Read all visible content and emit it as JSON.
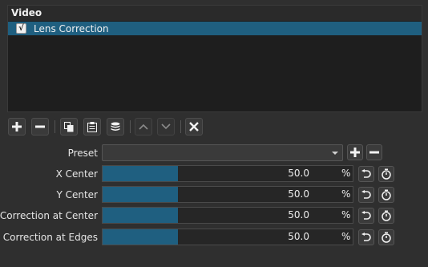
{
  "filter_list": {
    "header": "Video",
    "items": [
      {
        "label": "Lens Correction",
        "checked": true,
        "check_glyph": "√"
      }
    ]
  },
  "toolbar": {
    "buttons": [
      {
        "name": "add-filter-button",
        "icon": "plus-icon",
        "enabled": true
      },
      {
        "name": "remove-filter-button",
        "icon": "minus-icon",
        "enabled": true
      },
      {
        "name": "copy-filters-button",
        "icon": "copy-icon",
        "enabled": true
      },
      {
        "name": "paste-filters-button",
        "icon": "paste-icon",
        "enabled": true
      },
      {
        "name": "save-filter-set-button",
        "icon": "database-icon",
        "enabled": true
      },
      {
        "name": "move-up-button",
        "icon": "chevron-up-icon",
        "enabled": false
      },
      {
        "name": "move-down-button",
        "icon": "chevron-down-icon",
        "enabled": false
      },
      {
        "name": "deselect-button",
        "icon": "close-icon",
        "enabled": true
      }
    ]
  },
  "preset": {
    "label": "Preset",
    "value": ""
  },
  "params": [
    {
      "label": "X Center",
      "value": "50.0",
      "unit": "%",
      "level_percent": 30
    },
    {
      "label": "Y Center",
      "value": "50.0",
      "unit": "%",
      "level_percent": 30
    },
    {
      "label": "Correction at Center",
      "value": "50.0",
      "unit": "%",
      "level_percent": 30
    },
    {
      "label": "Correction at Edges",
      "value": "50.0",
      "unit": "%",
      "level_percent": 30
    }
  ],
  "colors": {
    "selection": "#1f5f80",
    "background": "#2f2f2f",
    "list_background": "#1e1e1e"
  }
}
